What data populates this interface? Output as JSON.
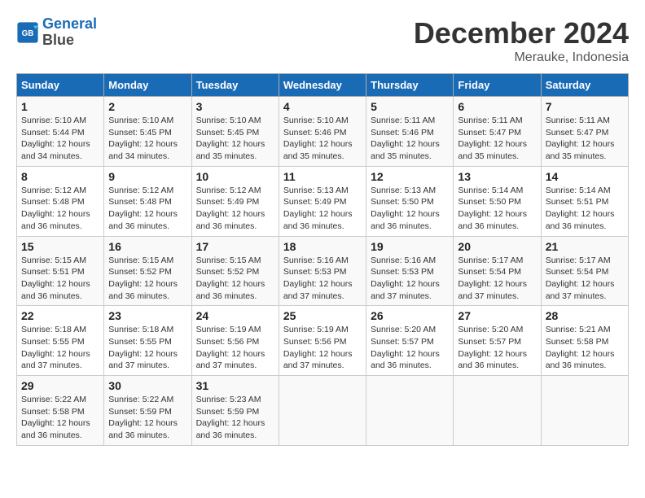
{
  "header": {
    "logo_line1": "General",
    "logo_line2": "Blue",
    "month": "December 2024",
    "location": "Merauke, Indonesia"
  },
  "weekdays": [
    "Sunday",
    "Monday",
    "Tuesday",
    "Wednesday",
    "Thursday",
    "Friday",
    "Saturday"
  ],
  "weeks": [
    [
      {
        "day": "1",
        "info": "Sunrise: 5:10 AM\nSunset: 5:44 PM\nDaylight: 12 hours\nand 34 minutes."
      },
      {
        "day": "2",
        "info": "Sunrise: 5:10 AM\nSunset: 5:45 PM\nDaylight: 12 hours\nand 34 minutes."
      },
      {
        "day": "3",
        "info": "Sunrise: 5:10 AM\nSunset: 5:45 PM\nDaylight: 12 hours\nand 35 minutes."
      },
      {
        "day": "4",
        "info": "Sunrise: 5:10 AM\nSunset: 5:46 PM\nDaylight: 12 hours\nand 35 minutes."
      },
      {
        "day": "5",
        "info": "Sunrise: 5:11 AM\nSunset: 5:46 PM\nDaylight: 12 hours\nand 35 minutes."
      },
      {
        "day": "6",
        "info": "Sunrise: 5:11 AM\nSunset: 5:47 PM\nDaylight: 12 hours\nand 35 minutes."
      },
      {
        "day": "7",
        "info": "Sunrise: 5:11 AM\nSunset: 5:47 PM\nDaylight: 12 hours\nand 35 minutes."
      }
    ],
    [
      {
        "day": "8",
        "info": "Sunrise: 5:12 AM\nSunset: 5:48 PM\nDaylight: 12 hours\nand 36 minutes."
      },
      {
        "day": "9",
        "info": "Sunrise: 5:12 AM\nSunset: 5:48 PM\nDaylight: 12 hours\nand 36 minutes."
      },
      {
        "day": "10",
        "info": "Sunrise: 5:12 AM\nSunset: 5:49 PM\nDaylight: 12 hours\nand 36 minutes."
      },
      {
        "day": "11",
        "info": "Sunrise: 5:13 AM\nSunset: 5:49 PM\nDaylight: 12 hours\nand 36 minutes."
      },
      {
        "day": "12",
        "info": "Sunrise: 5:13 AM\nSunset: 5:50 PM\nDaylight: 12 hours\nand 36 minutes."
      },
      {
        "day": "13",
        "info": "Sunrise: 5:14 AM\nSunset: 5:50 PM\nDaylight: 12 hours\nand 36 minutes."
      },
      {
        "day": "14",
        "info": "Sunrise: 5:14 AM\nSunset: 5:51 PM\nDaylight: 12 hours\nand 36 minutes."
      }
    ],
    [
      {
        "day": "15",
        "info": "Sunrise: 5:15 AM\nSunset: 5:51 PM\nDaylight: 12 hours\nand 36 minutes."
      },
      {
        "day": "16",
        "info": "Sunrise: 5:15 AM\nSunset: 5:52 PM\nDaylight: 12 hours\nand 36 minutes."
      },
      {
        "day": "17",
        "info": "Sunrise: 5:15 AM\nSunset: 5:52 PM\nDaylight: 12 hours\nand 36 minutes."
      },
      {
        "day": "18",
        "info": "Sunrise: 5:16 AM\nSunset: 5:53 PM\nDaylight: 12 hours\nand 37 minutes."
      },
      {
        "day": "19",
        "info": "Sunrise: 5:16 AM\nSunset: 5:53 PM\nDaylight: 12 hours\nand 37 minutes."
      },
      {
        "day": "20",
        "info": "Sunrise: 5:17 AM\nSunset: 5:54 PM\nDaylight: 12 hours\nand 37 minutes."
      },
      {
        "day": "21",
        "info": "Sunrise: 5:17 AM\nSunset: 5:54 PM\nDaylight: 12 hours\nand 37 minutes."
      }
    ],
    [
      {
        "day": "22",
        "info": "Sunrise: 5:18 AM\nSunset: 5:55 PM\nDaylight: 12 hours\nand 37 minutes."
      },
      {
        "day": "23",
        "info": "Sunrise: 5:18 AM\nSunset: 5:55 PM\nDaylight: 12 hours\nand 37 minutes."
      },
      {
        "day": "24",
        "info": "Sunrise: 5:19 AM\nSunset: 5:56 PM\nDaylight: 12 hours\nand 37 minutes."
      },
      {
        "day": "25",
        "info": "Sunrise: 5:19 AM\nSunset: 5:56 PM\nDaylight: 12 hours\nand 37 minutes."
      },
      {
        "day": "26",
        "info": "Sunrise: 5:20 AM\nSunset: 5:57 PM\nDaylight: 12 hours\nand 36 minutes."
      },
      {
        "day": "27",
        "info": "Sunrise: 5:20 AM\nSunset: 5:57 PM\nDaylight: 12 hours\nand 36 minutes."
      },
      {
        "day": "28",
        "info": "Sunrise: 5:21 AM\nSunset: 5:58 PM\nDaylight: 12 hours\nand 36 minutes."
      }
    ],
    [
      {
        "day": "29",
        "info": "Sunrise: 5:22 AM\nSunset: 5:58 PM\nDaylight: 12 hours\nand 36 minutes."
      },
      {
        "day": "30",
        "info": "Sunrise: 5:22 AM\nSunset: 5:59 PM\nDaylight: 12 hours\nand 36 minutes."
      },
      {
        "day": "31",
        "info": "Sunrise: 5:23 AM\nSunset: 5:59 PM\nDaylight: 12 hours\nand 36 minutes."
      },
      {
        "day": "",
        "info": ""
      },
      {
        "day": "",
        "info": ""
      },
      {
        "day": "",
        "info": ""
      },
      {
        "day": "",
        "info": ""
      }
    ]
  ]
}
